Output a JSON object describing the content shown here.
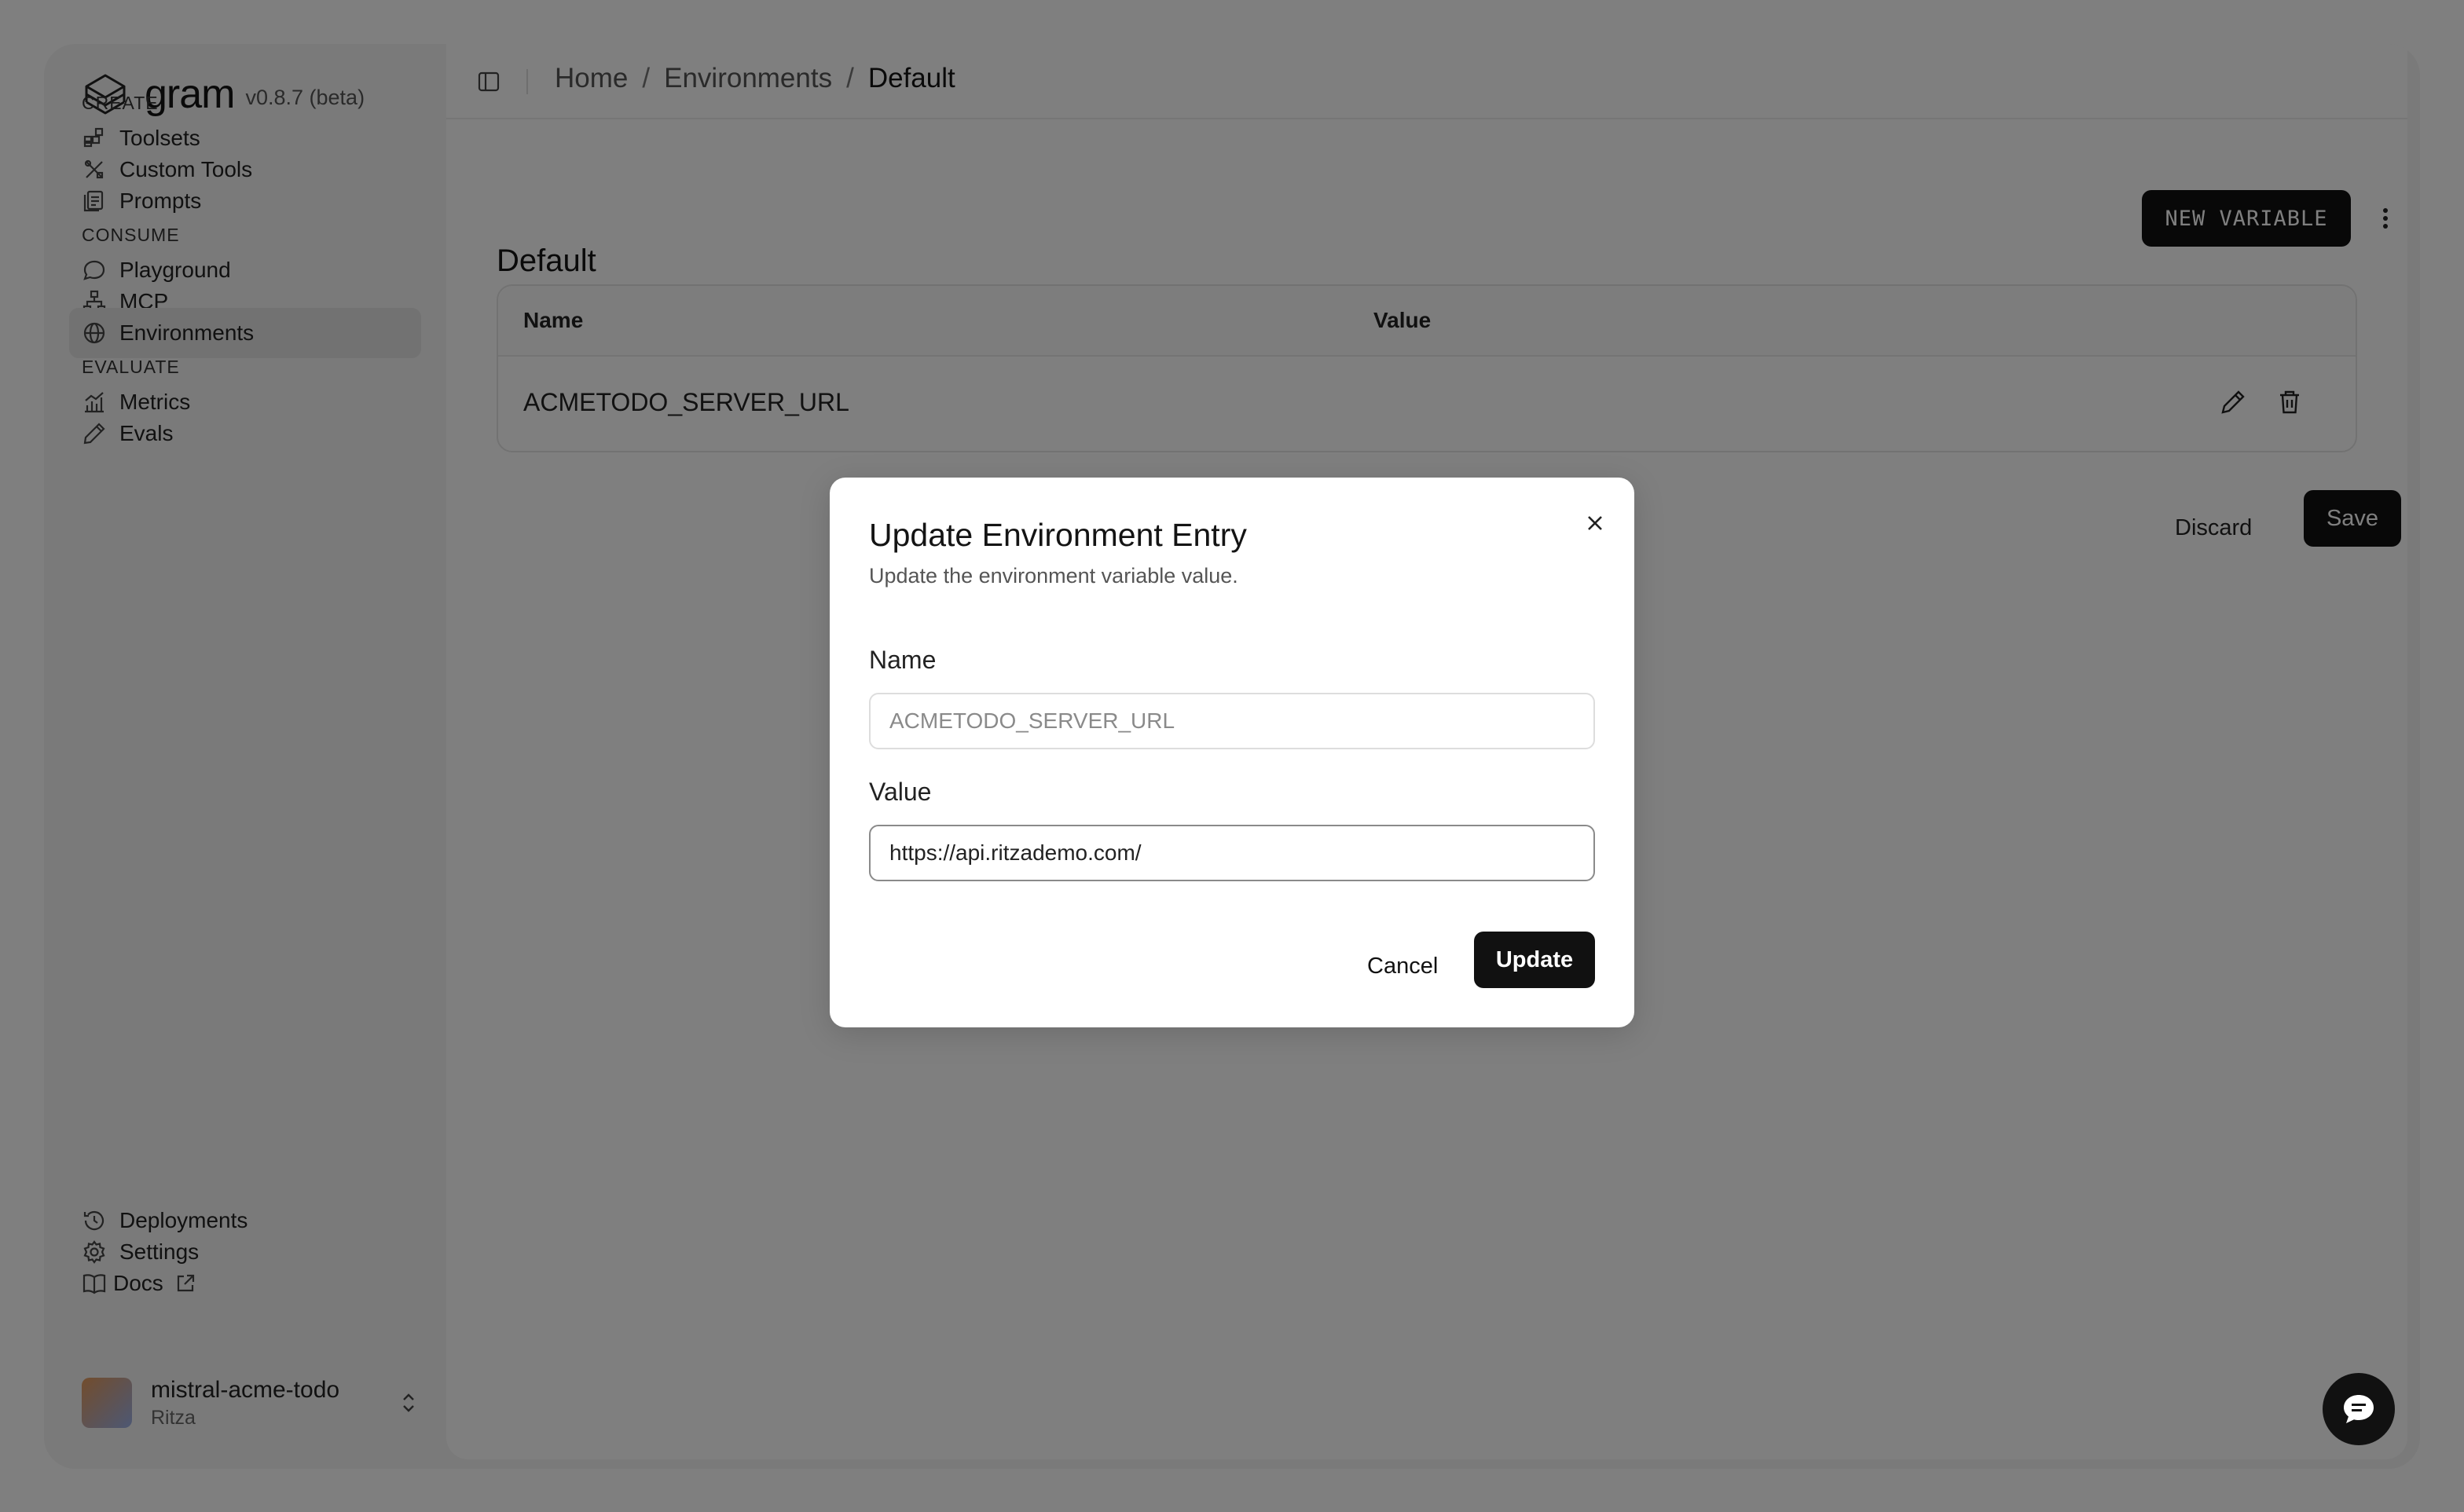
{
  "brand": {
    "name": "gram",
    "version": "v0.8.7 (beta)"
  },
  "sidebar": {
    "sections": [
      {
        "label": "CREATE",
        "items": [
          {
            "label": "Toolsets",
            "icon": "toolsets-icon"
          },
          {
            "label": "Custom Tools",
            "icon": "custom-tools-icon"
          },
          {
            "label": "Prompts",
            "icon": "prompts-icon"
          }
        ]
      },
      {
        "label": "CONSUME",
        "items": [
          {
            "label": "Playground",
            "icon": "chat-bubble-icon"
          },
          {
            "label": "MCP",
            "icon": "network-icon"
          },
          {
            "label": "Environments",
            "icon": "globe-icon",
            "active": true
          }
        ]
      },
      {
        "label": "EVALUATE",
        "items": [
          {
            "label": "Metrics",
            "icon": "chart-icon"
          },
          {
            "label": "Evals",
            "icon": "pencil-icon"
          }
        ]
      }
    ],
    "bottom": [
      {
        "label": "Deployments",
        "icon": "history-icon"
      },
      {
        "label": "Settings",
        "icon": "gear-icon"
      },
      {
        "label": "Docs",
        "icon": "book-icon"
      }
    ],
    "org": {
      "name": "mistral-acme-todo",
      "sub": "Ritza"
    }
  },
  "breadcrumb": {
    "home": "Home",
    "environments": "Environments",
    "current": "Default",
    "separator": "/"
  },
  "main": {
    "title": "Default",
    "new_variable_label": "NEW VARIABLE",
    "table": {
      "columns": [
        "Name",
        "Value"
      ],
      "rows": [
        {
          "name": "ACMETODO_SERVER_URL",
          "value": ""
        }
      ]
    },
    "discard_label": "Discard",
    "save_label": "Save"
  },
  "modal": {
    "title": "Update Environment Entry",
    "description": "Update the environment variable value.",
    "name_label": "Name",
    "name_value": "ACMETODO_SERVER_URL",
    "value_label": "Value",
    "value_value": "https://api.ritzademo.com/",
    "cancel_label": "Cancel",
    "update_label": "Update"
  }
}
